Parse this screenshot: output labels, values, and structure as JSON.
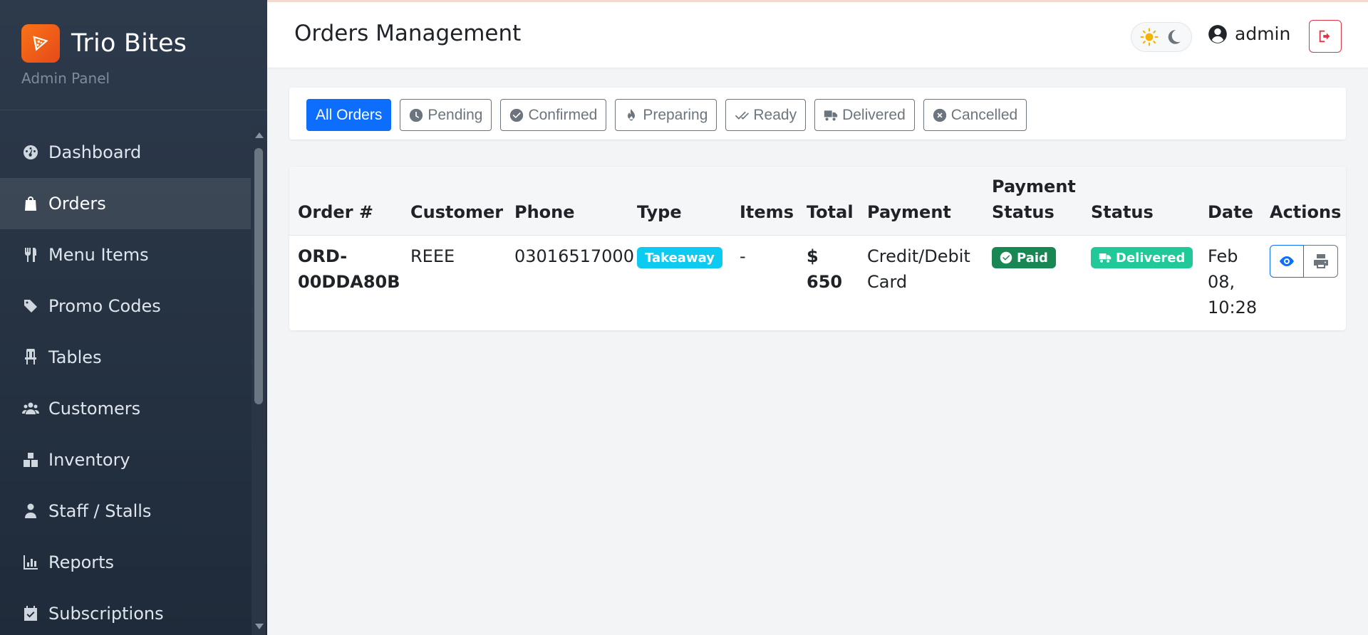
{
  "brand": {
    "name": "Trio Bites",
    "subtitle": "Admin Panel"
  },
  "sidebar": {
    "items": [
      {
        "label": "Dashboard",
        "icon": "gauge-icon",
        "active": false
      },
      {
        "label": "Orders",
        "icon": "shopping-bag-icon",
        "active": true
      },
      {
        "label": "Menu Items",
        "icon": "utensils-icon",
        "active": false
      },
      {
        "label": "Promo Codes",
        "icon": "tags-icon",
        "active": false
      },
      {
        "label": "Tables",
        "icon": "chair-icon",
        "active": false
      },
      {
        "label": "Customers",
        "icon": "users-icon",
        "active": false
      },
      {
        "label": "Inventory",
        "icon": "boxes-icon",
        "active": false
      },
      {
        "label": "Staff / Stalls",
        "icon": "user-tie-icon",
        "active": false
      },
      {
        "label": "Reports",
        "icon": "chart-icon",
        "active": false
      },
      {
        "label": "Subscriptions",
        "icon": "calendar-check-icon",
        "active": false
      }
    ]
  },
  "header": {
    "title": "Orders Management",
    "user": "admin"
  },
  "filters": [
    {
      "label": "All Orders",
      "icon": "",
      "active": true
    },
    {
      "label": "Pending",
      "icon": "clock-icon",
      "active": false
    },
    {
      "label": "Confirmed",
      "icon": "check-circle-icon",
      "active": false
    },
    {
      "label": "Preparing",
      "icon": "fire-icon",
      "active": false
    },
    {
      "label": "Ready",
      "icon": "double-check-icon",
      "active": false
    },
    {
      "label": "Delivered",
      "icon": "truck-icon",
      "active": false
    },
    {
      "label": "Cancelled",
      "icon": "x-circle-icon",
      "active": false
    }
  ],
  "table": {
    "headers": {
      "order": "Order #",
      "customer": "Customer",
      "phone": "Phone",
      "type": "Type",
      "items": "Items",
      "total": "Total",
      "payment": "Payment",
      "payment_status_1": "Payment",
      "payment_status_2": "Status",
      "status": "Status",
      "date": "Date",
      "actions": "Actions"
    },
    "rows": [
      {
        "order_1": "ORD-",
        "order_2": "00DDA80B",
        "customer": "REEE",
        "phone": "03016517000",
        "type": "Takeaway",
        "items": "-",
        "total_1": "$",
        "total_2": "650",
        "payment_1": "Credit/Debit",
        "payment_2": "Card",
        "payment_status": "Paid",
        "status": "Delivered",
        "date_1": "Feb",
        "date_2": "08,",
        "date_3": "10:28"
      }
    ]
  },
  "colors": {
    "primary": "#0d6efd",
    "danger": "#dc3545",
    "info": "#0dcaf0",
    "success": "#198754",
    "teal": "#20c997",
    "brand_orange": "#f97316"
  }
}
